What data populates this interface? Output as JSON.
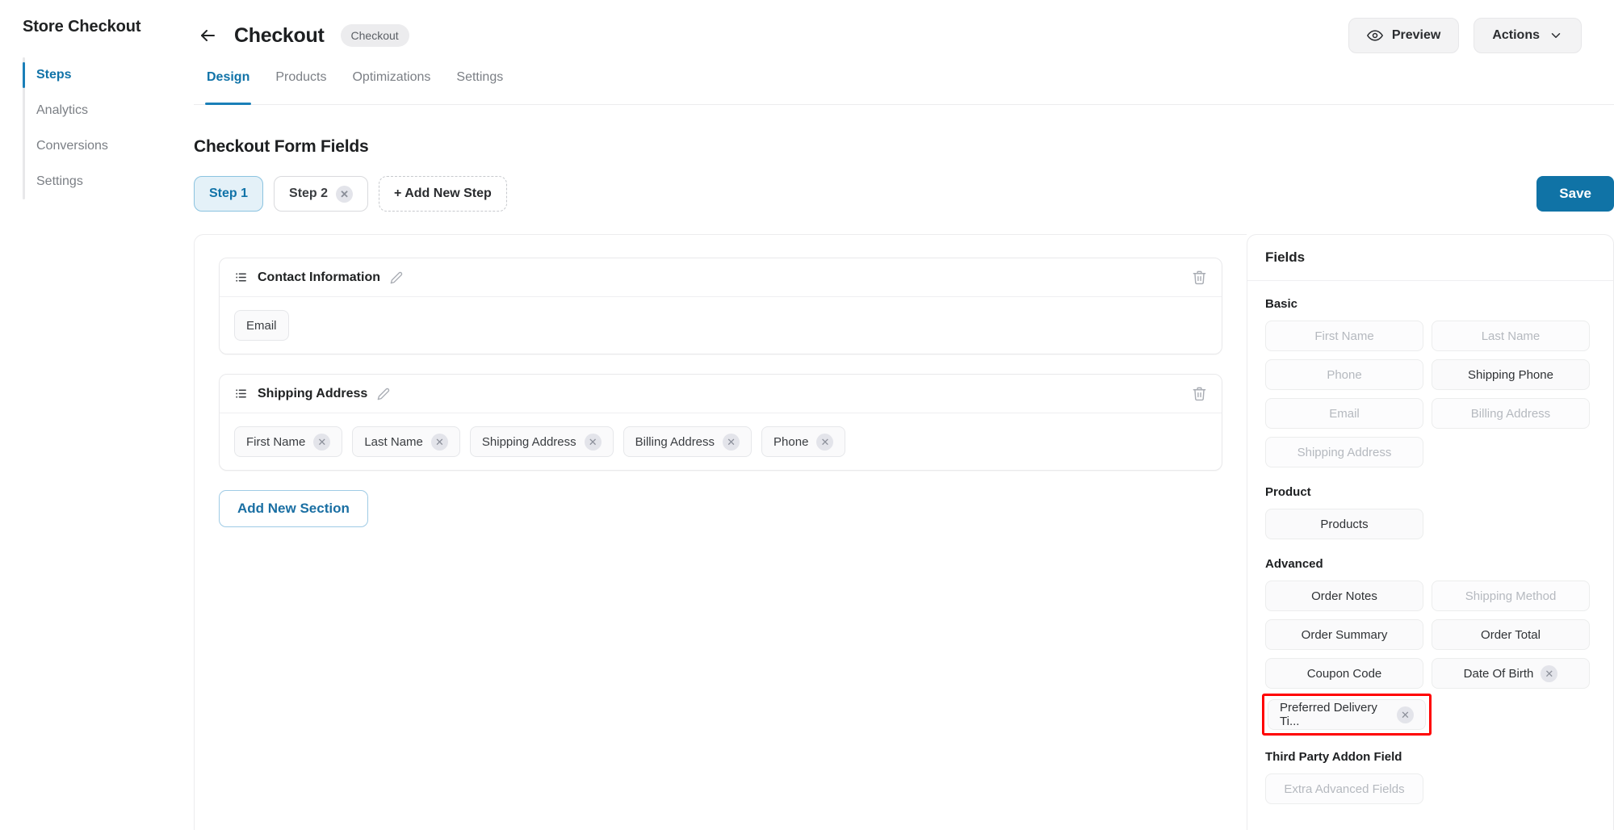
{
  "sidebar": {
    "title": "Store Checkout",
    "items": [
      {
        "label": "Steps",
        "active": true
      },
      {
        "label": "Analytics",
        "active": false
      },
      {
        "label": "Conversions",
        "active": false
      },
      {
        "label": "Settings",
        "active": false
      }
    ]
  },
  "header": {
    "back_icon": "arrow-left-icon",
    "title": "Checkout",
    "badge": "Checkout",
    "preview_label": "Preview",
    "preview_icon": "eye-icon",
    "actions_label": "Actions",
    "actions_icon": "chevron-down-icon"
  },
  "tabs": [
    {
      "label": "Design",
      "active": true
    },
    {
      "label": "Products",
      "active": false
    },
    {
      "label": "Optimizations",
      "active": false
    },
    {
      "label": "Settings",
      "active": false
    }
  ],
  "form": {
    "heading": "Checkout Form Fields",
    "steps": [
      {
        "label": "Step 1",
        "active": true,
        "removable": false
      },
      {
        "label": "Step 2",
        "active": false,
        "removable": true
      }
    ],
    "add_step_label": "+ Add New Step",
    "save_label": "Save",
    "add_section_label": "Add New Section"
  },
  "sections": [
    {
      "title": "Contact Information",
      "drag_icon": "list-handle-icon",
      "edit_icon": "pencil-icon",
      "delete_icon": "trash-icon",
      "fields": [
        {
          "label": "Email",
          "removable": false
        }
      ]
    },
    {
      "title": "Shipping Address",
      "drag_icon": "list-handle-icon",
      "edit_icon": "pencil-icon",
      "delete_icon": "trash-icon",
      "fields": [
        {
          "label": "First Name",
          "removable": true
        },
        {
          "label": "Last Name",
          "removable": true
        },
        {
          "label": "Shipping Address",
          "removable": true
        },
        {
          "label": "Billing Address",
          "removable": true
        },
        {
          "label": "Phone",
          "removable": true
        }
      ]
    }
  ],
  "fields_panel": {
    "title": "Fields",
    "groups": [
      {
        "title": "Basic",
        "items": [
          {
            "label": "First Name",
            "state": "muted",
            "removable": false
          },
          {
            "label": "Last Name",
            "state": "muted",
            "removable": false
          },
          {
            "label": "Phone",
            "state": "muted",
            "removable": false
          },
          {
            "label": "Shipping Phone",
            "state": "normal",
            "removable": false
          },
          {
            "label": "Email",
            "state": "muted",
            "removable": false
          },
          {
            "label": "Billing Address",
            "state": "muted",
            "removable": false
          },
          {
            "label": "Shipping Address",
            "state": "muted",
            "removable": false
          }
        ]
      },
      {
        "title": "Product",
        "items": [
          {
            "label": "Products",
            "state": "normal",
            "removable": false
          }
        ]
      },
      {
        "title": "Advanced",
        "items": [
          {
            "label": "Order Notes",
            "state": "normal",
            "removable": false
          },
          {
            "label": "Shipping Method",
            "state": "muted",
            "removable": false
          },
          {
            "label": "Order Summary",
            "state": "normal",
            "removable": false
          },
          {
            "label": "Order Total",
            "state": "normal",
            "removable": false
          },
          {
            "label": "Coupon Code",
            "state": "normal",
            "removable": false
          },
          {
            "label": "Date Of Birth",
            "state": "normal",
            "removable": true
          },
          {
            "label": "Preferred Delivery Ti...",
            "state": "normal",
            "removable": true,
            "highlighted": true
          }
        ]
      },
      {
        "title": "Third Party Addon Field",
        "items": [
          {
            "label": "Extra Advanced Fields",
            "state": "muted",
            "removable": false
          }
        ]
      }
    ]
  },
  "colors": {
    "accent": "#1173a8",
    "save_button": "#1073a6",
    "highlight": "#ff0000",
    "muted_text": "#b5b9bf"
  }
}
